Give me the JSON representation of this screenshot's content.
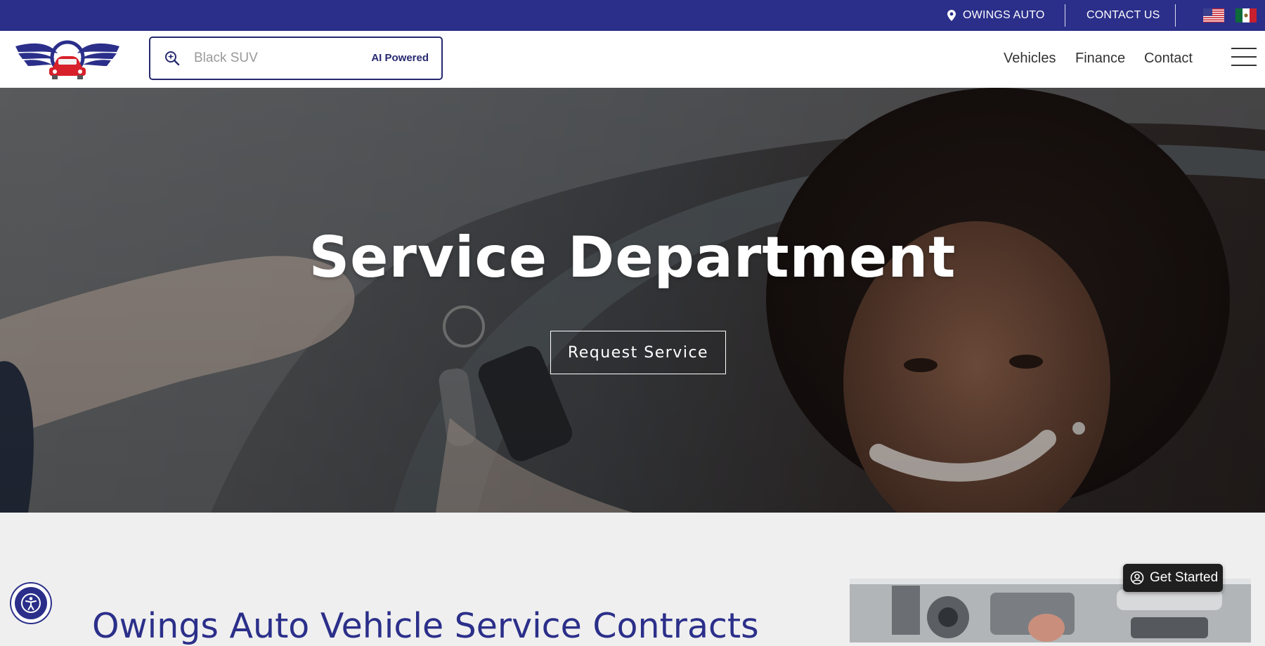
{
  "topbar": {
    "location_label": "OWINGS AUTO",
    "contact_label": "CONTACT US"
  },
  "header": {
    "search": {
      "placeholder": "Black SUV",
      "badge": "AI Powered"
    },
    "nav": [
      "Vehicles",
      "Finance",
      "Contact"
    ]
  },
  "hero": {
    "title": "Service Department",
    "button_label": "Request Service"
  },
  "content": {
    "section_title": "Owings Auto Vehicle Service Contracts"
  },
  "widgets": {
    "get_started_label": "Get Started"
  },
  "colors": {
    "brand_navy": "#2b2f8a",
    "accent_red": "#d8202a",
    "background": "#efefef"
  },
  "icons": [
    "location-pin-icon",
    "us-flag-icon",
    "mexico-flag-icon",
    "ai-search-icon",
    "hamburger-menu-icon",
    "user-circle-icon",
    "accessibility-icon"
  ]
}
